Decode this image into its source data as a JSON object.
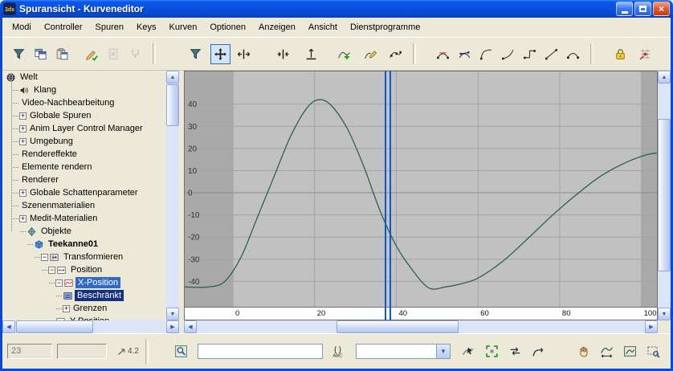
{
  "window": {
    "title": "Spuransicht - Kurveneditor",
    "app_icon": "3ds-max-track-view",
    "controls": [
      "minimize",
      "maximize",
      "close"
    ]
  },
  "menu": {
    "items": [
      "Modi",
      "Controller",
      "Spuren",
      "Keys",
      "Kurven",
      "Optionen",
      "Anzeigen",
      "Ansicht",
      "Dienstprogramme"
    ]
  },
  "toolbar": {
    "groups": [
      {
        "buttons": [
          {
            "name": "filters",
            "icon": "funnel"
          },
          {
            "name": "copy-controller",
            "icon": "copy"
          },
          {
            "name": "paste-controller",
            "icon": "paste"
          },
          {
            "name": "assign-controller",
            "icon": "pencil-check",
            "space": 10
          },
          {
            "name": "delete-controller",
            "icon": "doc-delete",
            "disabled": true
          },
          {
            "name": "make-controller-unique",
            "icon": "make-unique",
            "disabled": true
          }
        ]
      },
      {
        "buttons": [
          {
            "name": "track-filters",
            "icon": "funnel"
          },
          {
            "name": "move-keys",
            "icon": "move-cross",
            "active": true,
            "space": 4
          },
          {
            "name": "slide-keys",
            "icon": "slide-arrows",
            "space": 2
          },
          {
            "name": "scale-keys",
            "icon": "scale-keys",
            "space": 22
          },
          {
            "name": "scale-values",
            "icon": "scale-values",
            "space": 8
          },
          {
            "name": "add-keys",
            "icon": "add-key",
            "space": 14
          },
          {
            "name": "draw-curves",
            "icon": "draw-curve",
            "space": 6
          },
          {
            "name": "reduce-keys",
            "icon": "reduce-curve",
            "space": 4
          }
        ]
      },
      {
        "buttons": [
          {
            "name": "set-tangents-auto",
            "icon": "tangent-auto"
          },
          {
            "name": "set-tangents-custom",
            "icon": "tangent-custom"
          },
          {
            "name": "set-tangents-fast",
            "icon": "tangent-fast"
          },
          {
            "name": "set-tangents-slow",
            "icon": "tangent-slow"
          },
          {
            "name": "set-tangents-step",
            "icon": "tangent-step"
          },
          {
            "name": "set-tangents-linear",
            "icon": "tangent-linear"
          },
          {
            "name": "set-tangents-smooth",
            "icon": "tangent-smooth"
          }
        ]
      },
      {
        "buttons": [
          {
            "name": "lock-selection",
            "icon": "padlock"
          },
          {
            "name": "snap-frames",
            "icon": "snap",
            "space": 4
          }
        ]
      }
    ]
  },
  "tree": {
    "items": [
      {
        "label": "Welt",
        "level": 0,
        "icon": "globe"
      },
      {
        "label": "Klang",
        "level": 1,
        "icon": "speaker"
      },
      {
        "label": "Video-Nachbearbeitung",
        "level": 1
      },
      {
        "label": "Globale Spuren",
        "level": 1,
        "expander": "plus"
      },
      {
        "label": "Anim Layer Control Manager",
        "level": 1,
        "expander": "plus"
      },
      {
        "label": "Umgebung",
        "level": 1,
        "expander": "plus"
      },
      {
        "label": "Rendereffekte",
        "level": 1
      },
      {
        "label": "Elemente rendern",
        "level": 1
      },
      {
        "label": "Renderer",
        "level": 1
      },
      {
        "label": "Globale Schattenparameter",
        "level": 1,
        "expander": "plus"
      },
      {
        "label": "Szenenmaterialien",
        "level": 1
      },
      {
        "label": "Medit-Materialien",
        "level": 1,
        "expander": "plus"
      },
      {
        "label": "Objekte",
        "level": 2,
        "icon": "objects"
      },
      {
        "label": "Teekanne01",
        "level": 3,
        "icon": "cube",
        "bold": true
      },
      {
        "label": "Transformieren",
        "level": 4,
        "icon": "transform",
        "expander": "minus"
      },
      {
        "label": "Position",
        "level": 5,
        "icon": "position",
        "expander": "minus"
      },
      {
        "label": "X-Position",
        "level": 6,
        "icon": "xpos",
        "expander": "minus",
        "selected": "active"
      },
      {
        "label": "Beschränkt",
        "level": 7,
        "icon": "limited",
        "selected": "inactive"
      },
      {
        "label": "Grenzen",
        "level": 7,
        "expander": "plus"
      },
      {
        "label": "Y-Position",
        "level": 6,
        "icon": "ypos"
      }
    ]
  },
  "chart_data": {
    "type": "line",
    "x_ticks": [
      0,
      20,
      40,
      60,
      80,
      100
    ],
    "y_ticks": [
      40,
      30,
      20,
      10,
      0,
      -10,
      -20,
      -30,
      -40
    ],
    "x_view_range": [
      -12,
      104
    ],
    "y_view_range": [
      -51.8,
      55.1
    ],
    "active_range": [
      0,
      100
    ],
    "time_slider_frame": 38,
    "grid": true,
    "series": [
      {
        "name": "X-Position",
        "color": "#2a6158",
        "points": [
          [
            -12,
            -42.5
          ],
          [
            -6,
            -42.5
          ],
          [
            -2,
            -40
          ],
          [
            2,
            -29
          ],
          [
            6,
            -11
          ],
          [
            10,
            7
          ],
          [
            14,
            25
          ],
          [
            18,
            38
          ],
          [
            21,
            42
          ],
          [
            24,
            39.5
          ],
          [
            28,
            29
          ],
          [
            32,
            12
          ],
          [
            36,
            -8
          ],
          [
            40,
            -24
          ],
          [
            44,
            -35
          ],
          [
            48,
            -43
          ],
          [
            52,
            -42.5
          ],
          [
            56,
            -41
          ],
          [
            60,
            -38.5
          ],
          [
            66,
            -31
          ],
          [
            72,
            -21
          ],
          [
            78,
            -10.5
          ],
          [
            84,
            -1
          ],
          [
            90,
            7.5
          ],
          [
            96,
            13.5
          ],
          [
            101,
            17
          ],
          [
            104,
            18
          ]
        ]
      }
    ]
  },
  "statusbar": {
    "key_time": "23",
    "key_value": "",
    "spinner_label": "4.2",
    "selection_field": "",
    "track_set_field": "",
    "left_buttons": [
      {
        "name": "zoom-selected-object",
        "icon": "magnifier-box"
      }
    ],
    "edit_track_set_button": [
      {
        "name": "edit-track-set",
        "icon": "braces-abc"
      }
    ],
    "middle_buttons": [
      {
        "name": "show-selected-curves",
        "icon": "curve-arrow"
      },
      {
        "name": "frame-selected-keys",
        "icon": "green-frame"
      },
      {
        "name": "interactive-update",
        "icon": "swap-arrows"
      },
      {
        "name": "auto-update",
        "icon": "arrow-curve"
      }
    ],
    "right_buttons": [
      {
        "name": "pan",
        "icon": "hand"
      },
      {
        "name": "zoom-horizontal-extents",
        "icon": "curve-extents"
      },
      {
        "name": "zoom-value-extents",
        "icon": "curve-frame"
      },
      {
        "name": "zoom-region",
        "icon": "zoom-region"
      }
    ]
  },
  "colors": {
    "selection": "#316ac5",
    "selection_inactive": "#16307e",
    "curve": "#2a6158",
    "time_slider": "#1256cd",
    "chart_bg": "#c1c1c1",
    "chart_out_of_range": "#a9a9a9",
    "grid_line": "#a3a3a3",
    "zero_line": "#8a8a8a"
  }
}
